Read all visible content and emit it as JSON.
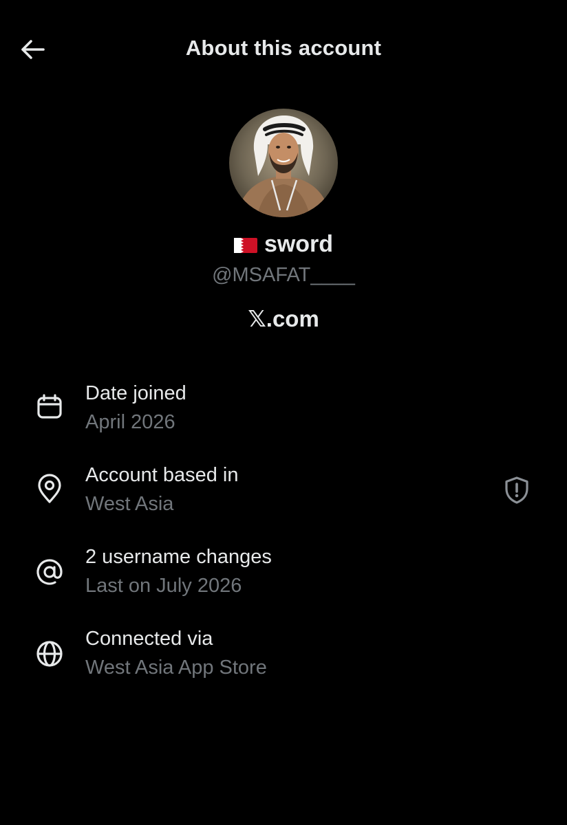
{
  "header": {
    "title": "About this account",
    "back_icon": "arrow-left-icon"
  },
  "profile": {
    "flag_icon": "bahrain-flag-icon",
    "display_name": "sword",
    "handle": "@MSAFAT____",
    "platform": "𝕏.com"
  },
  "details": [
    {
      "icon": "calendar-icon",
      "label": "Date joined",
      "value": "April 2026"
    },
    {
      "icon": "location-pin-icon",
      "label": "Account based in",
      "value": "West Asia",
      "action_icon": "shield-alert-icon"
    },
    {
      "icon": "at-sign-icon",
      "label": "2 username changes",
      "value": "Last on July 2026"
    },
    {
      "icon": "globe-icon",
      "label": "Connected via",
      "value": "West Asia App Store"
    }
  ],
  "colors": {
    "background": "#000000",
    "primary_text": "#e7e9ea",
    "secondary_text": "#71767b",
    "flag_red": "#ce1126"
  }
}
